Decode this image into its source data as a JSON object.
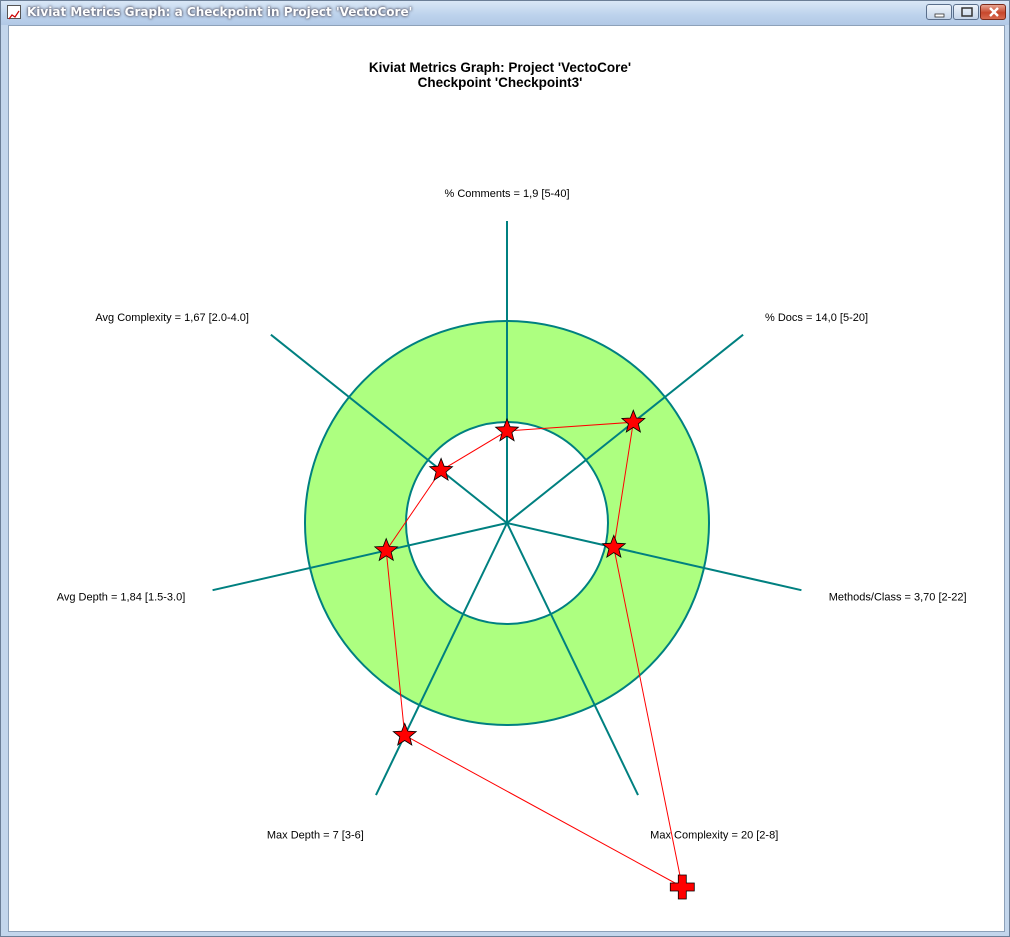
{
  "window": {
    "title": "Kiviat Metrics Graph: a Checkpoint in Project 'VectoCore'",
    "icon": "chart-icon"
  },
  "colors": {
    "band": "#adff80",
    "axis": "#008080",
    "marker": "#ff0000",
    "polyline": "#ff0000"
  },
  "chart_data": {
    "type": "radar",
    "title": "Kiviat Metrics Graph: Project 'VectoCore'",
    "subtitle": "Checkpoint 'Checkpoint3'",
    "axes": [
      {
        "label": "% Comments = 1,9 [5-40]",
        "value": 1.9,
        "range": [
          5,
          40
        ],
        "marker": "star"
      },
      {
        "label": "% Docs = 14,0 [5-20]",
        "value": 14.0,
        "range": [
          5,
          20
        ],
        "marker": "star"
      },
      {
        "label": "Methods/Class = 3,70 [2-22]",
        "value": 3.7,
        "range": [
          2,
          22
        ],
        "marker": "star"
      },
      {
        "label": "Max Complexity = 20 [2-8]",
        "value": 20,
        "range": [
          2,
          8
        ],
        "marker": "cross"
      },
      {
        "label": "Max Depth = 7 [3-6]",
        "value": 7,
        "range": [
          3,
          6
        ],
        "marker": "star"
      },
      {
        "label": "Avg Depth = 1,84 [1.5-3.0]",
        "value": 1.84,
        "range": [
          1.5,
          3.0
        ],
        "marker": "star"
      },
      {
        "label": "Avg Complexity = 1,67 [2.0-4.0]",
        "value": 1.67,
        "range": [
          2.0,
          4.0
        ],
        "marker": "star"
      }
    ]
  }
}
